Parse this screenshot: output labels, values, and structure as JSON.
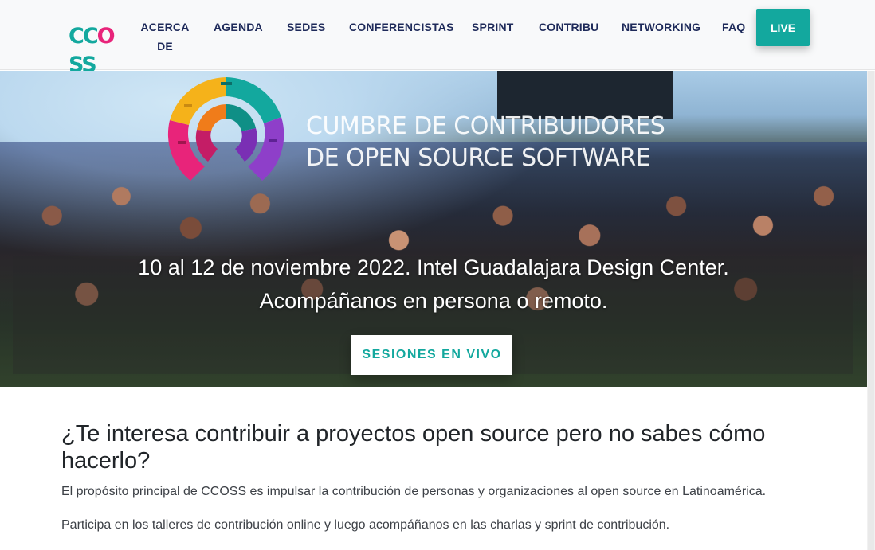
{
  "nav": {
    "logo_text": "CCOSS",
    "items": [
      {
        "label": "ACERCA",
        "label2": "DE"
      },
      {
        "label": "AGENDA"
      },
      {
        "label": "SEDES"
      },
      {
        "label": "CONFERENCISTAS"
      },
      {
        "label": "SPRINT"
      },
      {
        "label": "CONTRIBU"
      },
      {
        "label": "NETWORKING"
      },
      {
        "label": "FAQ"
      }
    ],
    "live_label": "LIVE"
  },
  "hero": {
    "title_line1": "CUMBRE DE CONTRIBUIDORES",
    "title_line2": "DE OPEN SOURCE SOFTWARE",
    "subtitle_line1": "10 al 12 de noviembre 2022. Intel Guadalajara Design Center.",
    "subtitle_line2": "Acompáñanos en persona o remoto.",
    "button_label": "SESIONES EN VIVO"
  },
  "content": {
    "heading": "¿Te interesa contribuir a proyectos open source pero no sabes cómo hacerlo?",
    "paragraph1": "El propósito principal de CCOSS es impulsar la contribución de personas y organizaciones al open source en Latinoamérica.",
    "paragraph2": "Participa en los talleres de contribución online y luego acompáñanos en las charlas y sprint de contribución."
  },
  "colors": {
    "accent": "#13a89e",
    "nav_text": "#1e2a5a",
    "logo_c1": "#13a89e",
    "logo_o": "#e8247a",
    "logo_s": "#13a89e"
  }
}
